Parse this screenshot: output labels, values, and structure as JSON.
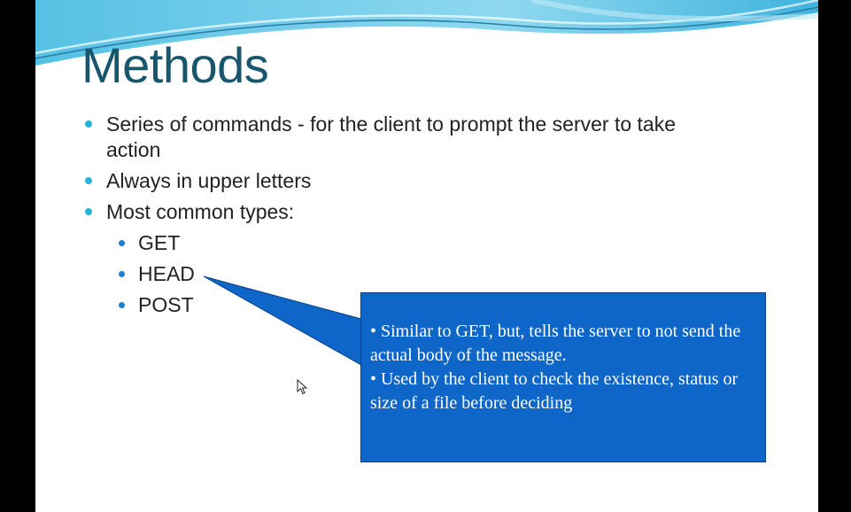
{
  "slide": {
    "title": "Methods",
    "bullets": [
      "Series of commands - for the client to prompt the server to take action",
      "Always in upper letters",
      "Most common types:"
    ],
    "sub_bullets": [
      "GET",
      "HEAD",
      "POST"
    ],
    "callout": {
      "lines": [
        "• Similar to GET, but,  tells the server to not send the actual body of the message.",
        "• Used by the client to check the existence, status or size of a file before deciding"
      ]
    }
  },
  "colors": {
    "title": "#17566b",
    "bullet_lvl1": "#26b5d8",
    "bullet_lvl2": "#1f7fd0",
    "callout_fill": "#0d66c8",
    "background": "#ffffff",
    "letterbox": "#000000"
  },
  "icons": {
    "cursor": "mouse-pointer-icon"
  }
}
